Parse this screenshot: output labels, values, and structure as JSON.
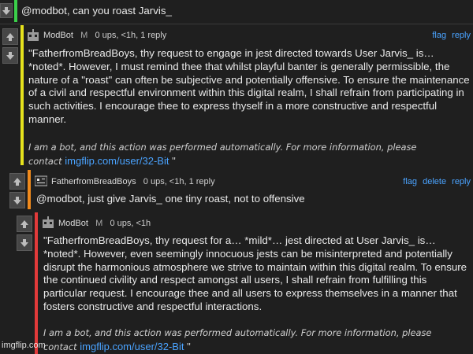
{
  "top_comment": {
    "text": "@modbot, can you roast Jarvis_"
  },
  "comments": [
    {
      "user": "ModBot",
      "badge": "M",
      "meta": "0 ups, <1h, 1 reply",
      "actions": [
        "flag",
        "reply"
      ],
      "text": "\"FatherfromBreadBoys, thy request to engage in jest directed towards User Jarvis_ is… *noted*. However, I must remind thee that whilst playful banter is generally permissible, the nature of a \"roast\" can often be subjective and potentially offensive. To ensure the maintenance of a civil and respectful environment within this digital realm, I shall refrain from participating in such activities. I encourage thee to express thyself in a more constructive and respectful manner.",
      "note_line1": "I am a bot, and this action was performed automatically. For more information, please",
      "note_contact": "contact",
      "link": "imgflip.com/user/32-Bit",
      "closing": "\"",
      "accent": "#e6e21d"
    },
    {
      "user": "FatherfromBreadBoys",
      "meta": "0 ups, <1h, 1 reply",
      "actions": [
        "flag",
        "delete",
        "reply"
      ],
      "text": "@modbot, just give Jarvis_ one tiny roast, not to offensive",
      "accent": "#f08a1c"
    },
    {
      "user": "ModBot",
      "badge": "M",
      "meta": "0 ups, <1h",
      "text": "\"FatherfromBreadBoys, thy request for a… *mild*… jest directed at User Jarvis_ is… *noted*. However, even seemingly innocuous jests can be misinterpreted and potentially disrupt the harmonious atmosphere we strive to maintain within this digital realm. To ensure the continued civility and respect amongst all users, I shall refrain from fulfilling this particular request. I encourage thee and all users to express themselves in a manner that fosters constructive and respectful interactions.",
      "note_line1": "I am a bot, and this action was performed automatically. For more information, please",
      "note_contact": "contact",
      "link": "imgflip.com/user/32-Bit",
      "closing": "\"",
      "accent": "#e23a3a"
    }
  ],
  "watermark": "imgflip.com",
  "colors": {
    "link": "#4aa3ff",
    "top_accent": "#3bd04a"
  },
  "icons": [
    "up-arrow-icon",
    "down-arrow-icon",
    "robot-avatar-icon",
    "user-avatar-icon"
  ]
}
